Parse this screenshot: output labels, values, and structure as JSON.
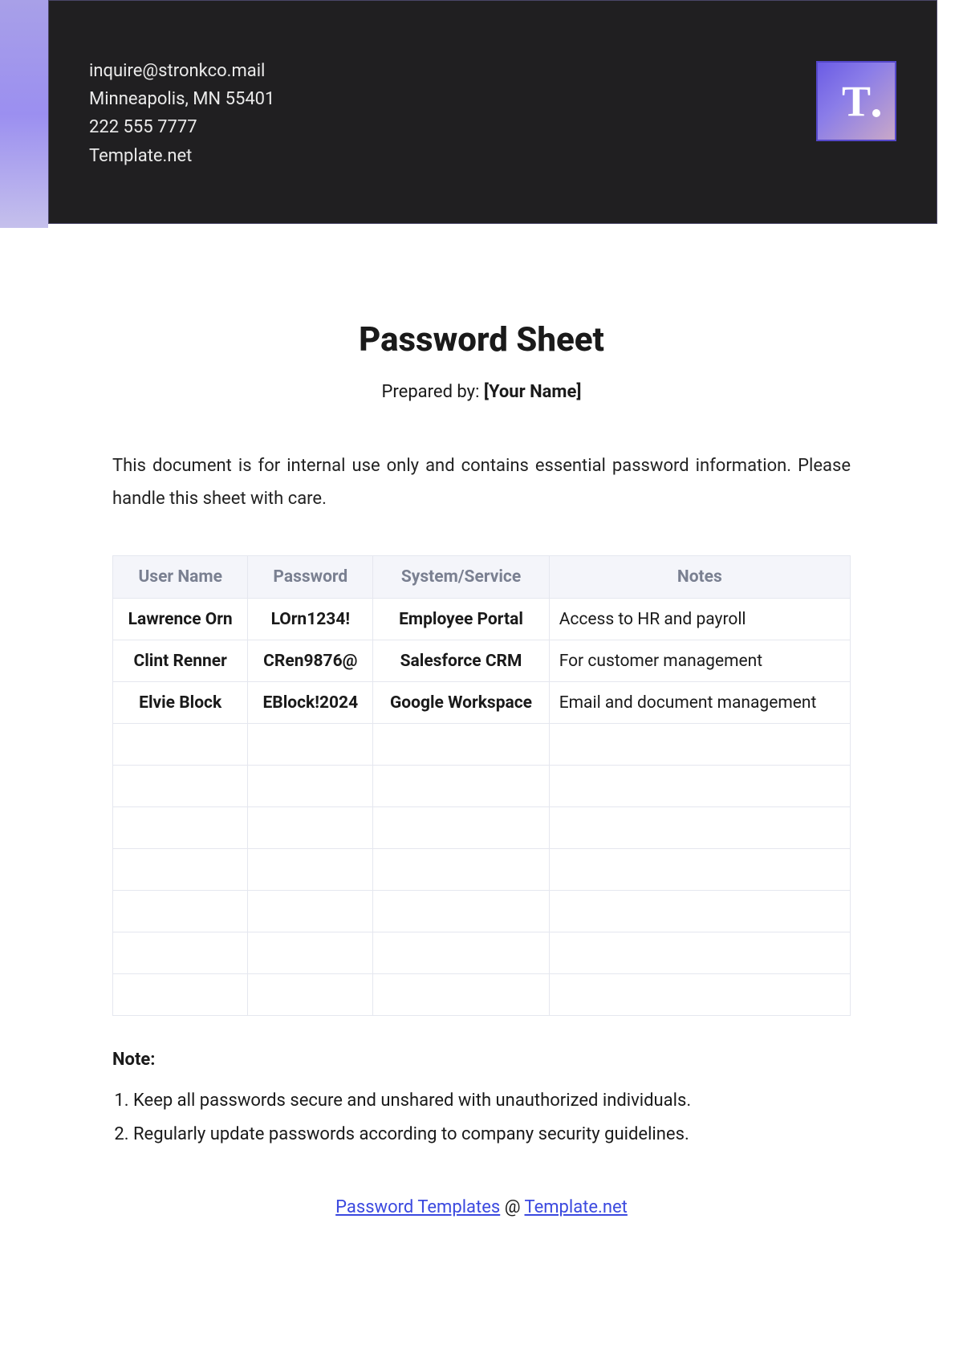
{
  "header": {
    "email": "inquire@stronkco.mail",
    "location": "Minneapolis, MN 55401",
    "phone": "222 555 7777",
    "site": "Template.net",
    "logo_letter": "T"
  },
  "title": "Password Sheet",
  "prepared_label": "Prepared by: ",
  "prepared_name": "[Your Name]",
  "intro": "This document is for internal use only and contains essential password information. Please handle this sheet with care.",
  "table": {
    "headers": {
      "user": "User Name",
      "password": "Password",
      "system": "System/Service",
      "notes": "Notes"
    },
    "rows": [
      {
        "user": "Lawrence Orn",
        "password": "LOrn1234!",
        "system": "Employee Portal",
        "notes": "Access to HR and payroll"
      },
      {
        "user": "Clint Renner",
        "password": "CRen9876@",
        "system": "Salesforce CRM",
        "notes": "For customer management"
      },
      {
        "user": "Elvie Block",
        "password": "EBlock!2024",
        "system": "Google Workspace",
        "notes": "Email and document management"
      }
    ],
    "empty_rows": 7
  },
  "note_heading": "Note:",
  "notes": [
    "Keep all passwords secure and unshared with unauthorized individuals.",
    "Regularly update passwords according to company security guidelines."
  ],
  "footer": {
    "link1": "Password Templates",
    "at": " @ ",
    "link2": "Template.net"
  }
}
